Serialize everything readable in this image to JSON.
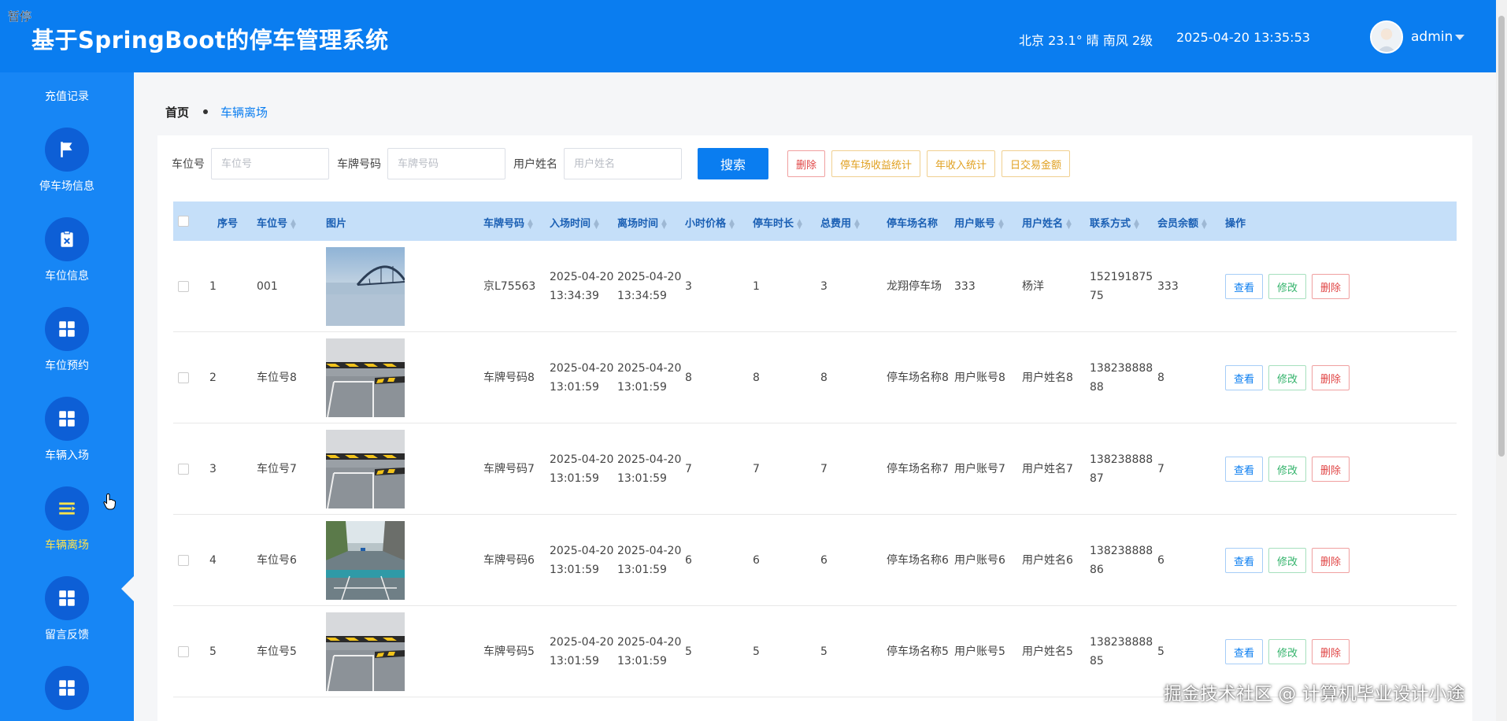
{
  "header": {
    "pause_label": "暂停",
    "title": "基于SpringBoot的停车管理系统",
    "weather": "北京  23.1°  晴  南风  2级",
    "datetime": "2025-04-20 13:35:53",
    "user": "admin"
  },
  "sidebar": {
    "top_item": "充值记录",
    "items": [
      {
        "label": "停车场信息",
        "icon": "flag-icon"
      },
      {
        "label": "车位信息",
        "icon": "clipboard-x-icon"
      },
      {
        "label": "车位预约",
        "icon": "grid-icon"
      },
      {
        "label": "车辆入场",
        "icon": "grid-icon"
      },
      {
        "label": "车辆离场",
        "icon": "list-icon",
        "active": true
      },
      {
        "label": "留言反馈",
        "icon": "grid-icon"
      },
      {
        "label": "",
        "icon": "grid-icon"
      }
    ]
  },
  "breadcrumb": {
    "home": "首页",
    "current": "车辆离场"
  },
  "search": {
    "fields": [
      {
        "label": "车位号",
        "placeholder": "车位号"
      },
      {
        "label": "车牌号码",
        "placeholder": "车牌号码"
      },
      {
        "label": "用户姓名",
        "placeholder": "用户姓名"
      }
    ],
    "search_label": "搜索",
    "delete_label": "删除",
    "stats_label": "停车场收益统计",
    "annual_label": "年收入统计",
    "daily_label": "日交易金额"
  },
  "table": {
    "columns": [
      "序号",
      "车位号",
      "图片",
      "车牌号码",
      "入场时间",
      "离场时间",
      "小时价格",
      "停车时长",
      "总费用",
      "停车场名称",
      "用户账号",
      "用户姓名",
      "联系方式",
      "会员余额",
      "操作"
    ],
    "rows": [
      {
        "no": "1",
        "space": "001",
        "img": "bridge",
        "plate": "京L75563",
        "in1": "2025-04-20",
        "in2": "13:34:39",
        "out1": "2025-04-20",
        "out2": "13:34:59",
        "price": "3",
        "hours": "1",
        "total": "3",
        "lot": "龙翔停车场",
        "account": "333",
        "name": "杨洋",
        "phone1": "152191875",
        "phone2": "75",
        "balance": "333"
      },
      {
        "no": "2",
        "space": "车位号8",
        "img": "garage",
        "plate": "车牌号码8",
        "in1": "2025-04-20",
        "in2": "13:01:59",
        "out1": "2025-04-20",
        "out2": "13:01:59",
        "price": "8",
        "hours": "8",
        "total": "8",
        "lot": "停车场名称8",
        "account": "用户账号8",
        "name": "用户姓名8",
        "phone1": "138238888",
        "phone2": "88",
        "balance": "8"
      },
      {
        "no": "3",
        "space": "车位号7",
        "img": "garage",
        "plate": "车牌号码7",
        "in1": "2025-04-20",
        "in2": "13:01:59",
        "out1": "2025-04-20",
        "out2": "13:01:59",
        "price": "7",
        "hours": "7",
        "total": "7",
        "lot": "停车场名称7",
        "account": "用户账号7",
        "name": "用户姓名7",
        "phone1": "138238888",
        "phone2": "87",
        "balance": "7"
      },
      {
        "no": "4",
        "space": "车位号6",
        "img": "street",
        "plate": "车牌号码6",
        "in1": "2025-04-20",
        "in2": "13:01:59",
        "out1": "2025-04-20",
        "out2": "13:01:59",
        "price": "6",
        "hours": "6",
        "total": "6",
        "lot": "停车场名称6",
        "account": "用户账号6",
        "name": "用户姓名6",
        "phone1": "138238888",
        "phone2": "86",
        "balance": "6"
      },
      {
        "no": "5",
        "space": "车位号5",
        "img": "garage",
        "plate": "车牌号码5",
        "in1": "2025-04-20",
        "in2": "13:01:59",
        "out1": "2025-04-20",
        "out2": "13:01:59",
        "price": "5",
        "hours": "5",
        "total": "5",
        "lot": "停车场名称5",
        "account": "用户账号5",
        "name": "用户姓名5",
        "phone1": "138238888",
        "phone2": "85",
        "balance": "5"
      }
    ],
    "actions": {
      "view": "查看",
      "edit": "修改",
      "delete": "删除"
    }
  },
  "watermark": "掘金技术社区 @ 计算机毕业设计小途"
}
